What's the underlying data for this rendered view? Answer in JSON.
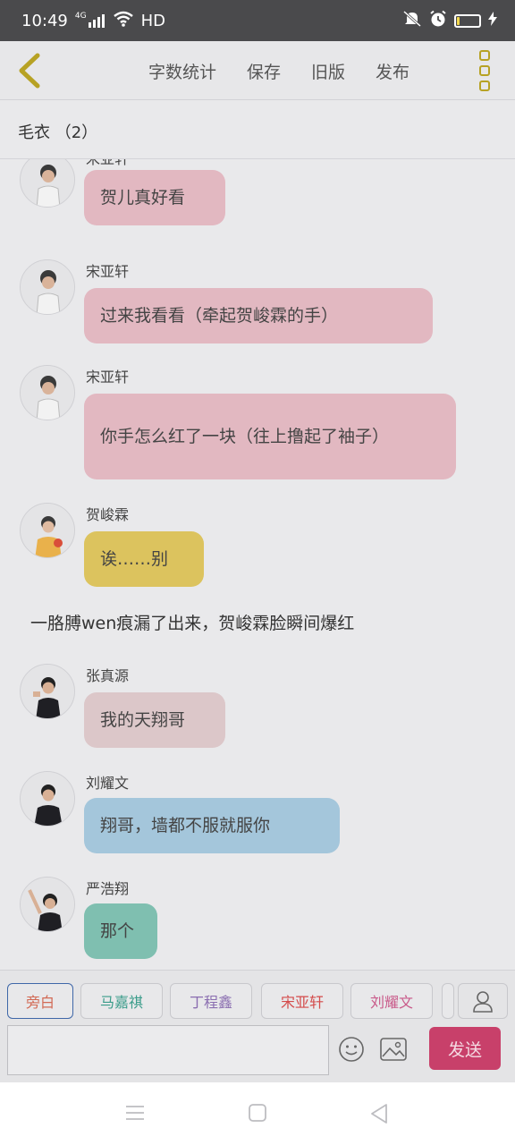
{
  "status_bar": {
    "time": "10:49",
    "network": "4G",
    "hd": "HD",
    "battery_level": 0.1
  },
  "toolbar": {
    "actions": [
      "字数统计",
      "保存",
      "旧版",
      "发布"
    ]
  },
  "title": "毛衣 （2）",
  "messages": [
    {
      "type": "chat",
      "sender": "宋亚轩",
      "text": "贺儿真好看",
      "color": "#e2b8c1"
    },
    {
      "type": "chat",
      "sender": "宋亚轩",
      "text": "过来我看看（牵起贺峻霖的手）",
      "color": "#e2b8c1"
    },
    {
      "type": "chat",
      "sender": "宋亚轩",
      "text": "你手怎么红了一块（往上撸起了袖子）",
      "color": "#e2b8c1"
    },
    {
      "type": "chat",
      "sender": "贺峻霖",
      "text": "诶……别",
      "color": "#dcc35e"
    },
    {
      "type": "narration",
      "text": "一胳膊wen痕漏了出来，贺峻霖脸瞬间爆红"
    },
    {
      "type": "chat",
      "sender": "张真源",
      "text": "我的天翔哥",
      "color": "#dcc7c9"
    },
    {
      "type": "chat",
      "sender": "刘耀文",
      "text": "翔哥，墙都不服就服你",
      "color": "#a4c6db"
    },
    {
      "type": "chat",
      "sender": "严浩翔",
      "text": "那个",
      "color": "#7fbfb0"
    }
  ],
  "roles": [
    {
      "label": "旁白",
      "color": "#d26a55"
    },
    {
      "label": "马嘉祺",
      "color": "#3a9c8a"
    },
    {
      "label": "丁程鑫",
      "color": "#8a6db0"
    },
    {
      "label": "宋亚轩",
      "color": "#d44b4b"
    },
    {
      "label": "刘耀文",
      "color": "#c95a8a"
    }
  ],
  "input": {
    "placeholder": "",
    "value": ""
  },
  "send_label": "发送",
  "colors": {
    "accent_yellow": "#b7a224",
    "send_button": "#c8406a",
    "selected_role_border": "#3f67a8"
  }
}
